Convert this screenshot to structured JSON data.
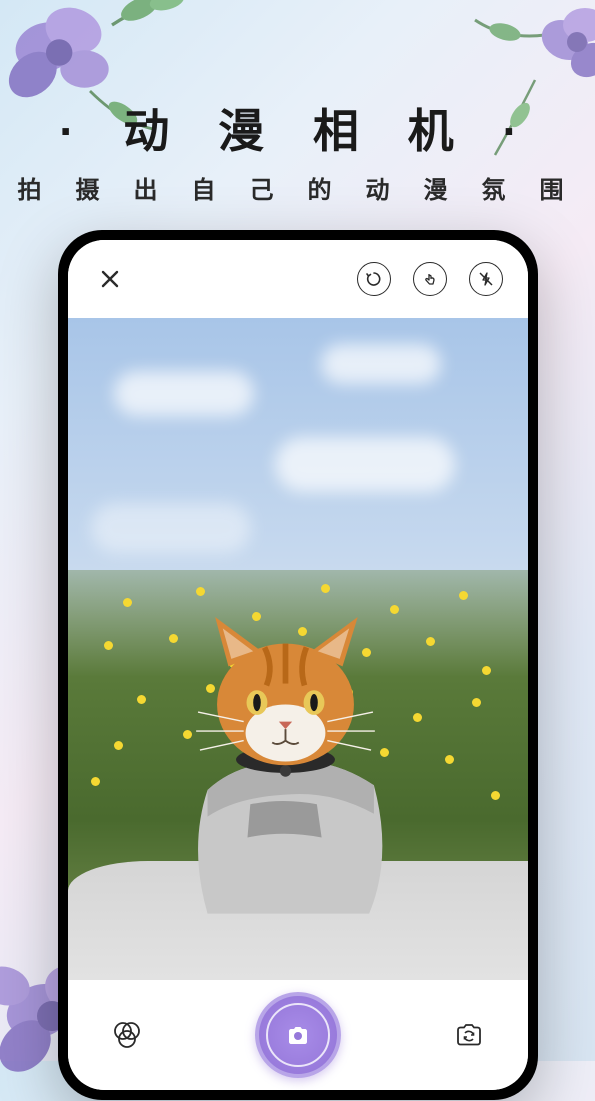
{
  "promo": {
    "title": "· 动 漫 相 机 ·",
    "subtitle": "拍 摄 出 自 己 的 动 漫 氛 围"
  },
  "camera": {
    "close_label": "close",
    "timer_label": "timer",
    "touch_label": "touch-shutter",
    "flash_label": "flash-off",
    "filter_label": "filter",
    "shutter_label": "shutter",
    "switch_label": "switch-camera"
  },
  "colors": {
    "shutter_accent": "#9678da",
    "shutter_ring": "#b8a5e8"
  }
}
